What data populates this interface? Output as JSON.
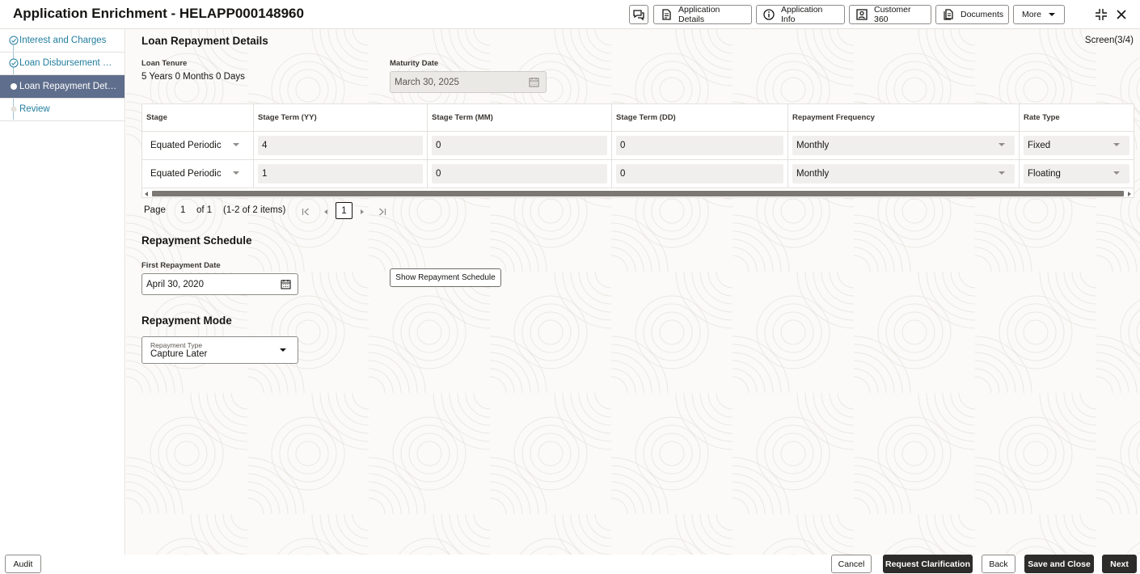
{
  "header": {
    "title": "Application Enrichment - HELAPP000148960",
    "buttons": {
      "application_details": "Application Details",
      "application_info": "Application Info",
      "customer_360": "Customer 360",
      "documents": "Documents",
      "more": "More"
    },
    "icons": [
      "chat-icon",
      "document-icon",
      "info-icon",
      "person-card-icon",
      "documents-icon",
      "chevron-down-icon",
      "collapse-icon",
      "close-icon"
    ]
  },
  "sidebar": {
    "items": [
      {
        "label": "Interest and Charges",
        "state": "done"
      },
      {
        "label": "Loan Disbursement Details",
        "state": "done"
      },
      {
        "label": "Loan Repayment Details",
        "state": "active"
      },
      {
        "label": "Review",
        "state": "pending"
      }
    ]
  },
  "main": {
    "section_title": "Loan Repayment Details",
    "screen": "Screen(3/4)",
    "loan_tenure": {
      "label": "Loan Tenure",
      "value": "5 Years 0 Months 0 Days"
    },
    "maturity_date": {
      "label": "Maturity Date",
      "value": "March 30, 2025"
    },
    "table": {
      "columns": [
        "Stage",
        "Stage Term (YY)",
        "Stage Term (MM)",
        "Stage Term (DD)",
        "Repayment Frequency",
        "Rate Type"
      ],
      "rows": [
        [
          "Equated Periodic",
          "4",
          "0",
          "0",
          "Monthly",
          "Fixed"
        ],
        [
          "Equated Periodic",
          "1",
          "0",
          "0",
          "Monthly",
          "Floating"
        ]
      ]
    },
    "pagination": {
      "page_label": "Page",
      "page": "1",
      "of_label": "of 1",
      "items": "(1-2 of 2 items)",
      "current": "1"
    },
    "repayment_schedule": {
      "title": "Repayment Schedule",
      "first_repayment_label": "First Repayment Date",
      "first_repayment_value": "April 30, 2020",
      "show_button": "Show Repayment Schedule"
    },
    "repayment_mode": {
      "title": "Repayment Mode",
      "type_label": "Repayment Type",
      "type_value": "Capture Later"
    }
  },
  "footer": {
    "audit": "Audit",
    "cancel": "Cancel",
    "request_clarification": "Request Clarification",
    "back": "Back",
    "save_and_close": "Save and Close",
    "next": "Next"
  },
  "colors": {
    "link": "#227e9e",
    "active_nav": "#5f6e8c",
    "dark_button": "#2e2c2a"
  }
}
